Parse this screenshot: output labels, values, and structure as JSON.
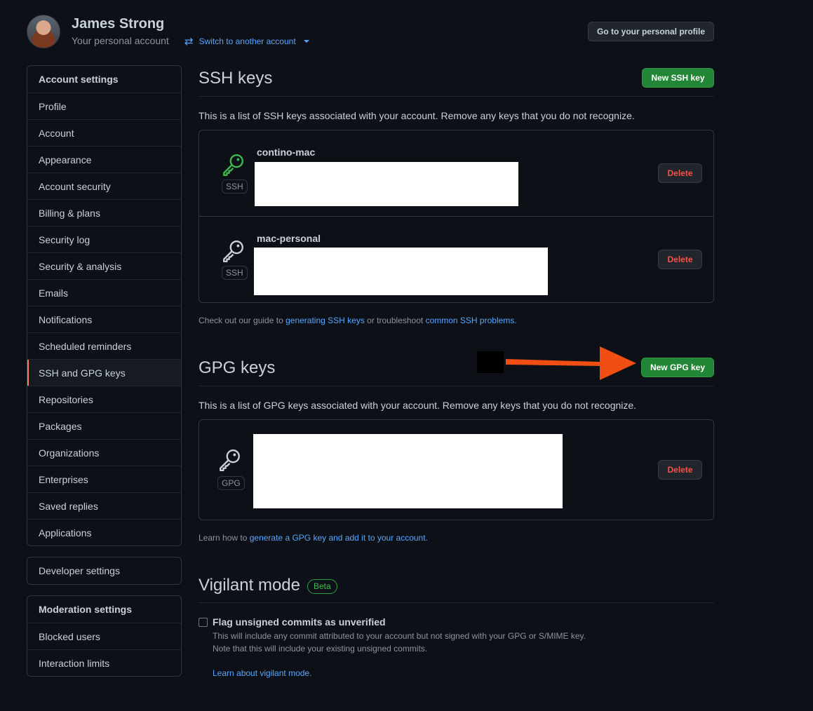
{
  "header": {
    "user_name": "James Strong",
    "account_type": "Your personal account",
    "switch_account": "Switch to another account",
    "profile_button": "Go to your personal profile"
  },
  "sidebar": {
    "account_group": {
      "heading": "Account settings",
      "items": [
        "Profile",
        "Account",
        "Appearance",
        "Account security",
        "Billing & plans",
        "Security log",
        "Security & analysis",
        "Emails",
        "Notifications",
        "Scheduled reminders",
        "SSH and GPG keys",
        "Repositories",
        "Packages",
        "Organizations",
        "Enterprises",
        "Saved replies",
        "Applications"
      ],
      "selected": "SSH and GPG keys"
    },
    "developer_settings": "Developer settings",
    "moderation_group": {
      "heading": "Moderation settings",
      "items": [
        "Blocked users",
        "Interaction limits"
      ]
    }
  },
  "ssh": {
    "title": "SSH keys",
    "new_button": "New SSH key",
    "description": "This is a list of SSH keys associated with your account. Remove any keys that you do not recognize.",
    "keys": [
      {
        "name": "contino-mac",
        "type": "SSH",
        "delete": "Delete",
        "active": true
      },
      {
        "name": "mac-personal",
        "type": "SSH",
        "delete": "Delete",
        "active": false
      }
    ],
    "footer_prefix": "Check out our guide to",
    "footer_link1": "generating SSH keys",
    "footer_middle": "or troubleshoot",
    "footer_link2": "common SSH problems",
    "footer_suffix": "."
  },
  "gpg": {
    "title": "GPG keys",
    "new_button": "New GPG key",
    "description": "This is a list of GPG keys associated with your account. Remove any keys that you do not recognize.",
    "keys": [
      {
        "type": "GPG",
        "delete": "Delete"
      }
    ],
    "footer_prefix": "Learn how to",
    "footer_link": "generate a GPG key and add it to your account",
    "footer_suffix": "."
  },
  "vigilant": {
    "title": "Vigilant mode",
    "badge": "Beta",
    "checkbox_label": "Flag unsigned commits as unverified",
    "checked": false,
    "note_line1": "This will include any commit attributed to your account but not signed with your GPG or S/MIME key.",
    "note_line2": "Note that this will include your existing unsigned commits.",
    "learn_link": "Learn about vigilant mode."
  },
  "colors": {
    "background": "#0d1117",
    "link": "#58a6ff",
    "green_button": "#238636",
    "danger": "#f85149",
    "selected_accent": "#f78166",
    "active_key": "#3fb950",
    "annotation_arrow": "#f04e12"
  },
  "icons": {
    "avatar": "user-avatar",
    "switch": "arrow-switch-icon",
    "key": "key-icon",
    "annotation": "arrow-right-annotation"
  }
}
